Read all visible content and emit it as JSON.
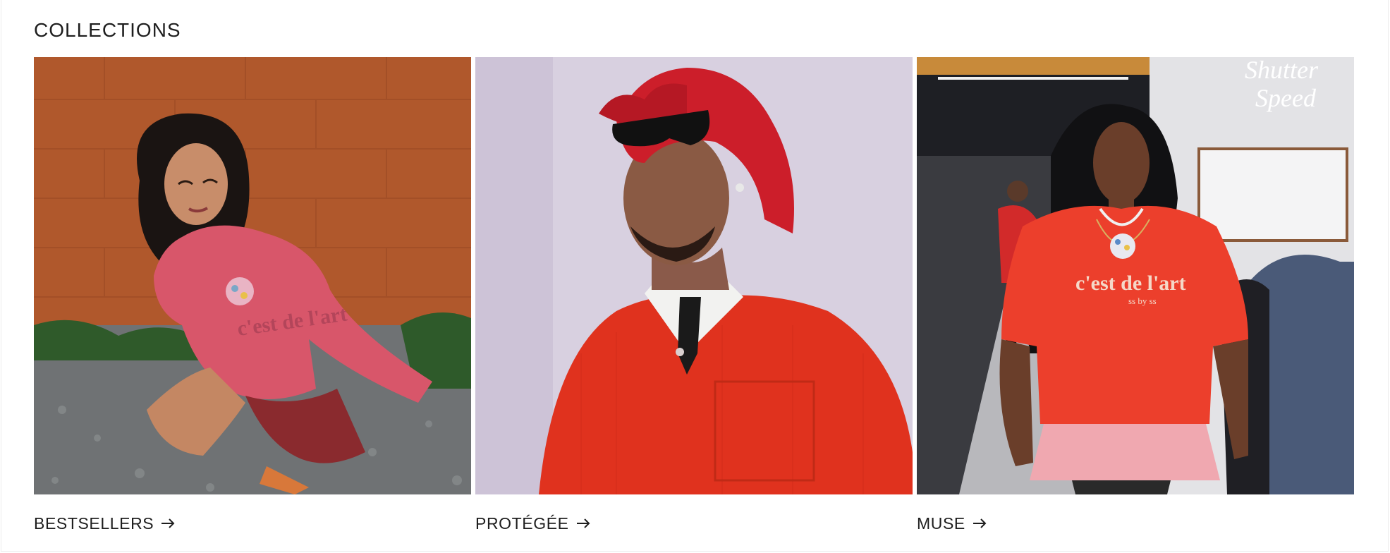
{
  "section": {
    "title": "COLLECTIONS"
  },
  "collections": [
    {
      "label": "BESTSELLERS",
      "image_alt": "Model in pink hoodie crouching by orange brick wall",
      "print": "c'est de l'art"
    },
    {
      "label": "PROTÉGÉE",
      "image_alt": "Model with red hair in red corduroy jacket",
      "print": ""
    },
    {
      "label": "MUSE",
      "image_alt": "Model in red tee on runway",
      "print": "c'est de l'art",
      "print_sub": "ss by ss",
      "neon": [
        "Shutter",
        "Speed"
      ]
    }
  ],
  "colors": {
    "text": "#1e1e1e",
    "background": "#ffffff"
  },
  "icons": {
    "link_arrow": "arrow-right-icon"
  }
}
